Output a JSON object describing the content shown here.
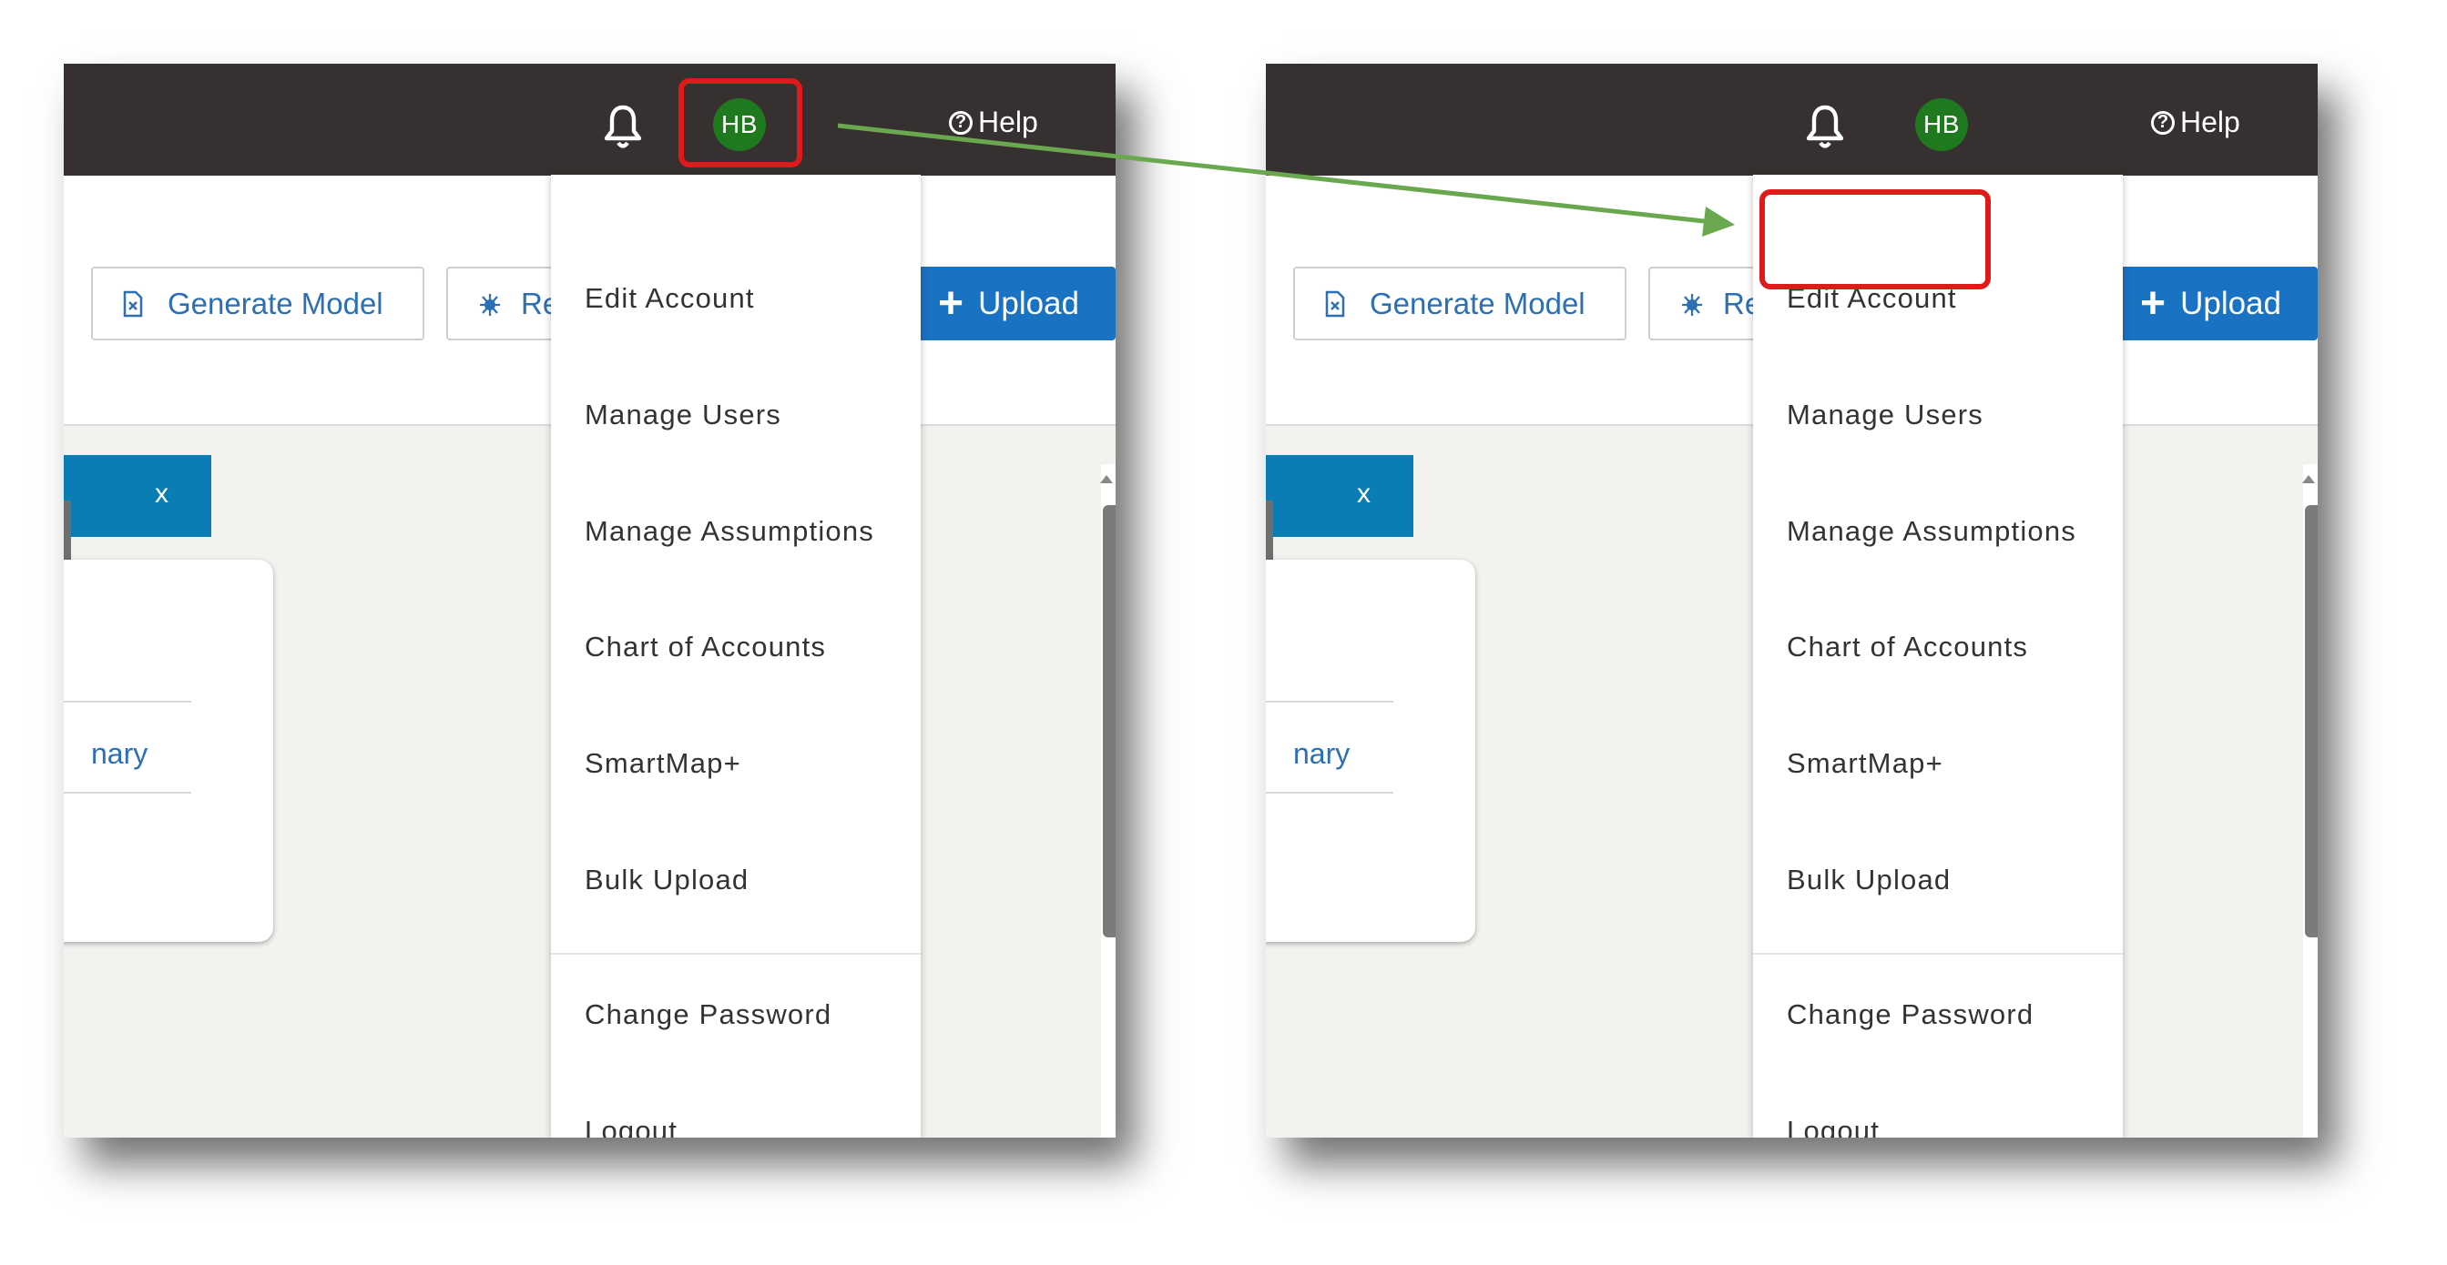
{
  "panels": {
    "left": {
      "user_initials": "HB",
      "help_label": "Help",
      "help_icon_glyph": "?",
      "generate_model_label": "Generate Model",
      "re_label": "Re",
      "upload_label": "Upload",
      "tab_close_label": "x",
      "card_link": "nary",
      "menu": {
        "items": [
          "Edit Account",
          "Manage Users",
          "Manage Assumptions",
          "Chart of Accounts",
          "SmartMap+",
          "Bulk Upload",
          "Change Password",
          "Logout"
        ]
      }
    },
    "right": {
      "user_initials": "HB",
      "help_label": "Help",
      "help_icon_glyph": "?",
      "generate_model_label": "Generate Model",
      "re_label": "Re",
      "upload_label": "Upload",
      "tab_close_label": "x",
      "card_link": "nary",
      "menu": {
        "items": [
          "Edit Account",
          "Manage Users",
          "Manage Assumptions",
          "Chart of Accounts",
          "SmartMap+",
          "Bulk Upload",
          "Change Password",
          "Logout"
        ]
      }
    }
  },
  "colors": {
    "topbar": "#363130",
    "avatar": "#1f7a1f",
    "accent_blue": "#1a73c2",
    "tab_header": "#0a7db5",
    "highlight_red": "#e0191b",
    "arrow_green": "#6aa84f"
  },
  "icons": {
    "notifications": "bell-icon",
    "help": "question-circle-icon",
    "generate_model": "document-x-icon",
    "re_button": "bug-icon",
    "upload": "plus-icon"
  }
}
